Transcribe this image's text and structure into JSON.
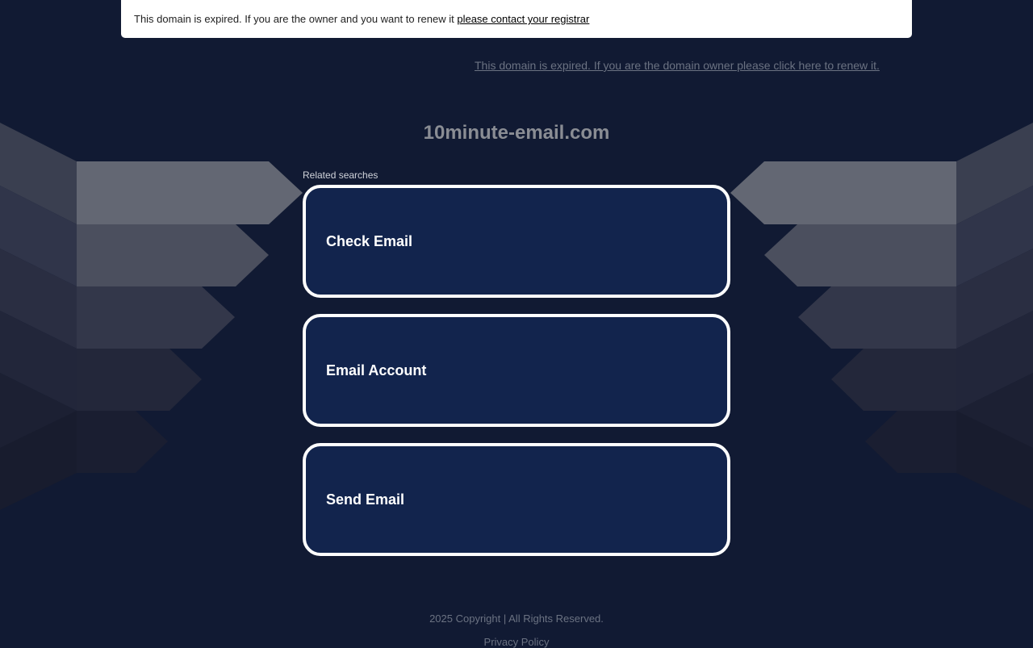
{
  "notice": {
    "text": "This domain is expired. If you are the owner and you want to renew it",
    "link": "please contact your registrar"
  },
  "renew_link": "This domain is expired. If you are the domain owner please click here to renew it.",
  "domain": "10minute-email.com",
  "related_label": "Related searches",
  "searches": [
    {
      "label": "Check Email"
    },
    {
      "label": "Email Account"
    },
    {
      "label": "Send Email"
    }
  ],
  "footer": {
    "copyright": "2025 Copyright | All Rights Reserved.",
    "privacy": "Privacy Policy"
  },
  "colors": {
    "background": "#111a33",
    "card_fill": "#12244d",
    "card_border": "#ffffff"
  }
}
